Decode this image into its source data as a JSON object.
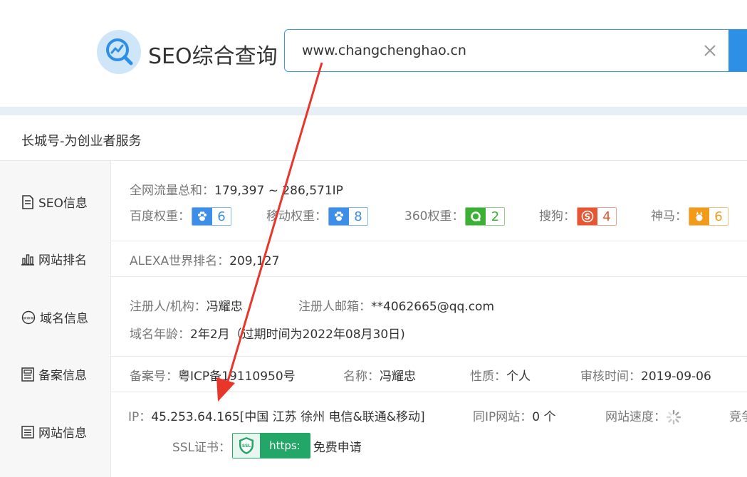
{
  "header": {
    "logo_text": "SEO综合查询",
    "search_value": "www.changchenghao.cn"
  },
  "site_title": "长城号-为创业者服务",
  "seo": {
    "label": "SEO信息",
    "traffic_key": "全网流量总和：",
    "traffic_value": "179,397 ~ 286,571IP",
    "weights": [
      {
        "key": "百度权重：",
        "value": "6",
        "icon": "baidu-paw-icon",
        "color": "#3d8ee8"
      },
      {
        "key": "移动权重：",
        "value": "8",
        "icon": "baidu-paw-icon",
        "color": "#3d8ee8"
      },
      {
        "key": "360权重：",
        "value": "2",
        "icon": "360-icon",
        "color": "#3cb034"
      },
      {
        "key": "搜狗：",
        "value": "4",
        "icon": "sogou-icon",
        "color": "#e85532"
      },
      {
        "key": "神马：",
        "value": "6",
        "icon": "shenma-icon",
        "color": "#f29a1a"
      }
    ]
  },
  "rank": {
    "label": "网站排名",
    "alexa_key": "ALEXA世界排名：",
    "alexa_value": "209,127"
  },
  "domain": {
    "label": "域名信息",
    "registrant_key": "注册人/机构：",
    "registrant_value": "冯耀忠",
    "email_key": "注册人邮箱：",
    "email_value": "**4062665@qq.com",
    "age_key": "域名年龄：",
    "age_value": "2年2月（过期时间为2022年08月30日)"
  },
  "icp": {
    "label": "备案信息",
    "number_key": "备案号：",
    "number_value": "粤ICP备19110950号",
    "name_key": "名称：",
    "name_value": "冯耀忠",
    "type_key": "性质：",
    "type_value": "个人",
    "audit_key": "审核时间：",
    "audit_value": "2019-09-06"
  },
  "site": {
    "label": "网站信息",
    "ip_key": "IP：",
    "ip_value": "45.253.64.165[中国 江苏 徐州 电信&联通&移动]",
    "sameip_key": "同IP网站：",
    "sameip_value": "0 个",
    "speed_key": "网站速度：",
    "trunc_key": "竞争",
    "ssl_key": "SSL证书：",
    "ssl_badge": "https:",
    "ssl_apply": "免费申请"
  }
}
